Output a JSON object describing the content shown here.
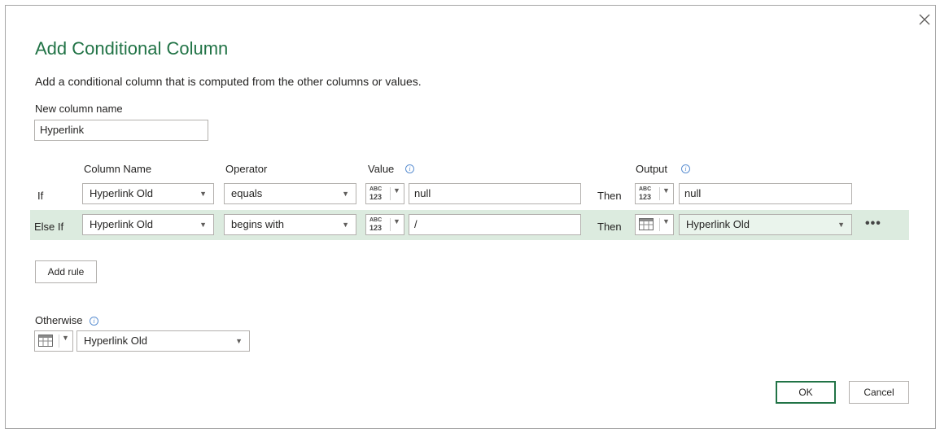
{
  "dialog": {
    "title": "Add Conditional Column",
    "subtitle": "Add a conditional column that is computed from the other columns or values.",
    "close_icon": "close-icon"
  },
  "new_column": {
    "label": "New column name",
    "value": "Hyperlink"
  },
  "headers": {
    "column_name": "Column Name",
    "operator": "Operator",
    "value": "Value",
    "output": "Output"
  },
  "type_icon": {
    "abc": "ABC",
    "num": "123"
  },
  "rules": [
    {
      "label": "If",
      "column": "Hyperlink Old",
      "operator": "equals",
      "value": "null",
      "then": "Then",
      "output": "null"
    },
    {
      "label": "Else If",
      "column": "Hyperlink Old",
      "operator": "begins with",
      "value": "/",
      "then": "Then",
      "output": "Hyperlink Old",
      "more": "•••"
    }
  ],
  "add_rule_label": "Add rule",
  "otherwise": {
    "label": "Otherwise",
    "value": "Hyperlink Old"
  },
  "buttons": {
    "ok": "OK",
    "cancel": "Cancel"
  },
  "colors": {
    "accent": "#217346",
    "row_highlight": "#dcebdf",
    "info": "#5b8fd1"
  }
}
